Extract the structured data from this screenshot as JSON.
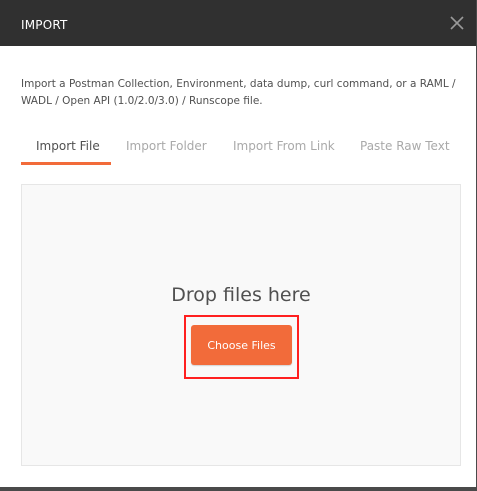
{
  "modal": {
    "title": "IMPORT",
    "close_icon": "close-icon",
    "description": "Import a Postman Collection, Environment, data dump, curl command, or a RAML / WADL / Open API (1.0/2.0/3.0) / Runscope file."
  },
  "tabs": [
    {
      "label": "Import File",
      "active": true
    },
    {
      "label": "Import Folder",
      "active": false
    },
    {
      "label": "Import From Link",
      "active": false
    },
    {
      "label": "Paste Raw Text",
      "active": false
    }
  ],
  "dropzone": {
    "text": "Drop files here",
    "button_label": "Choose Files"
  },
  "colors": {
    "header_bg": "#303030",
    "accent": "#f26b3a",
    "highlight": "#ff1f1f"
  }
}
